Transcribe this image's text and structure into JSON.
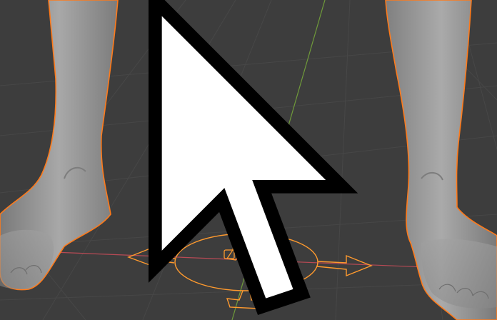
{
  "viewport": {
    "background": "#3d3d3d",
    "grid_color": "#4a4a4a",
    "x_axis_color": "#c0505a",
    "y_axis_color": "#6f9a3a",
    "selection_color": "#ff9a2e",
    "selection_outline_color": "#ff7a1a",
    "mesh_color": "#8e8e8e",
    "feet_model": "large-feet-mesh",
    "armature": "character-armature-selected",
    "gizmo": "move-gizmo",
    "cursor_icon": "arrow-cursor-icon",
    "origin_icon": "3d-cursor-icon"
  }
}
